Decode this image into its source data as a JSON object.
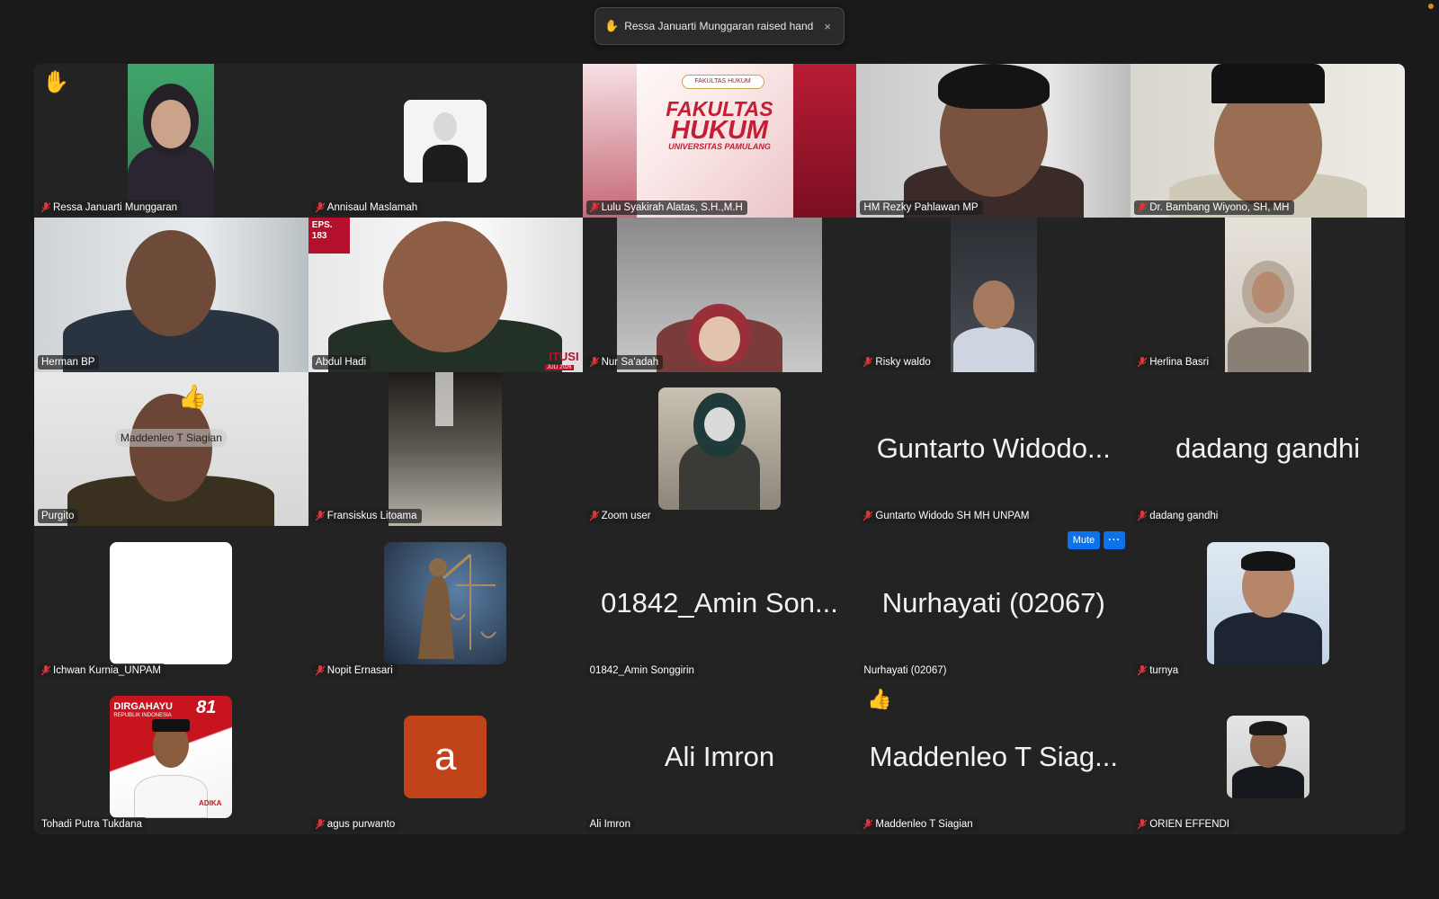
{
  "notification": {
    "text": "Ressa Januarti Munggaran raised hand",
    "close_label": "×"
  },
  "tiles": [
    {
      "name": "Ressa Januarti Munggaran",
      "muted": true,
      "raised_hand": true
    },
    {
      "name": "Annisaul Maslamah",
      "muted": true
    },
    {
      "name": "Lulu Syakirah Alatas, S.H.,M.H",
      "muted": true,
      "banner": {
        "top": "FAKULTAS HUKUM",
        "line1": "FAKULTAS",
        "line2": "HUKUM",
        "line3": "UNIVERSITAS PAMULANG"
      }
    },
    {
      "name": "HM Rezky Pahlawan MP",
      "muted": false
    },
    {
      "name": "Dr. Bambang Wiyono, SH, MH",
      "muted": true
    },
    {
      "name": "Herman BP",
      "muted": false
    },
    {
      "name": "Abdul Hadi",
      "muted": false,
      "speaking": true,
      "badge": "EPS.\n183",
      "badge_line1": "EPS.",
      "badge_line2": "183",
      "corner_text": "JULI 2026",
      "side_text": "ITUSI"
    },
    {
      "name": "Nur Sa'adah",
      "muted": true
    },
    {
      "name": "Risky waldo",
      "muted": true
    },
    {
      "name": "Herlina Basri",
      "muted": true
    },
    {
      "name": "Purgito",
      "muted": false,
      "overlay": "Maddenleo T Siagian"
    },
    {
      "name": "Fransiskus Litoama",
      "muted": true
    },
    {
      "name": "Zoom user",
      "muted": true
    },
    {
      "name": "Guntarto Widodo SH MH UNPAM",
      "muted": true,
      "display": "Guntarto Widodo..."
    },
    {
      "name": "dadang gandhi",
      "muted": true,
      "display": "dadang gandhi"
    },
    {
      "name": "Ichwan Kurnia_UNPAM",
      "muted": true
    },
    {
      "name": "Nopit Ernasari",
      "muted": true
    },
    {
      "name": "01842_Amin Songgirin",
      "muted": false,
      "display": "01842_Amin Son..."
    },
    {
      "name": "Nurhayati (02067)",
      "muted": false,
      "display": "Nurhayati (02067)",
      "mute_button": "Mute",
      "more_button": "···"
    },
    {
      "name": "turnya",
      "muted": true
    },
    {
      "name": "Tohadi Putra Tukdana",
      "muted": false,
      "poster": {
        "line1": "DIRGAHAYU",
        "line2": "REPUBLIK INDONESIA",
        "number": "81",
        "brand": "ADIKA"
      }
    },
    {
      "name": "agus purwanto",
      "muted": true,
      "initial": "a"
    },
    {
      "name": "Ali Imron",
      "muted": false,
      "display": "Ali Imron"
    },
    {
      "name": "Maddenleo T Siagian",
      "muted": true,
      "display": "Maddenleo T Siag...",
      "reaction": true
    },
    {
      "name": "ORIEN EFFENDI",
      "muted": true
    }
  ],
  "icons": {
    "raised_hand": "✋",
    "thumbs_up": "👍",
    "mic_off": "mic-off-icon"
  },
  "colors": {
    "background": "#1a1a1a",
    "tile": "#232323",
    "speaking_border": "#2ecc40",
    "mute_button": "#0e72ed",
    "mic_off": "#e0353b",
    "avatar_initial_bg": "#c0431a"
  }
}
